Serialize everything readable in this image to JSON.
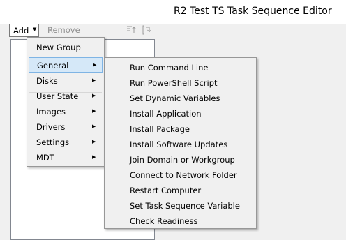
{
  "window": {
    "title": "R2 Test TS Task Sequence Editor"
  },
  "toolbar": {
    "add_label": "Add",
    "remove_label": "Remove",
    "move_up_icon": "move-up-icon",
    "move_down_icon": "move-down-icon"
  },
  "add_menu": {
    "items": [
      {
        "label": "New Group",
        "submenu": false
      },
      {
        "label": "General",
        "submenu": true,
        "highlighted": true
      },
      {
        "label": "Disks",
        "submenu": true
      },
      {
        "label": "User State",
        "submenu": true
      },
      {
        "label": "Images",
        "submenu": true
      },
      {
        "label": "Drivers",
        "submenu": true
      },
      {
        "label": "Settings",
        "submenu": true
      },
      {
        "label": "MDT",
        "submenu": true
      }
    ]
  },
  "general_submenu": {
    "items": [
      "Run Command Line",
      "Run PowerShell Script",
      "Set Dynamic Variables",
      "Install Application",
      "Install Package",
      "Install Software Updates",
      "Join Domain or Workgroup",
      "Connect to Network Folder",
      "Restart Computer",
      "Set Task Sequence Variable",
      "Check Readiness"
    ]
  },
  "colors": {
    "highlight_fill": "#d5e8f8",
    "highlight_border": "#7fb4e4",
    "menu_bg": "#f0f0f0"
  }
}
